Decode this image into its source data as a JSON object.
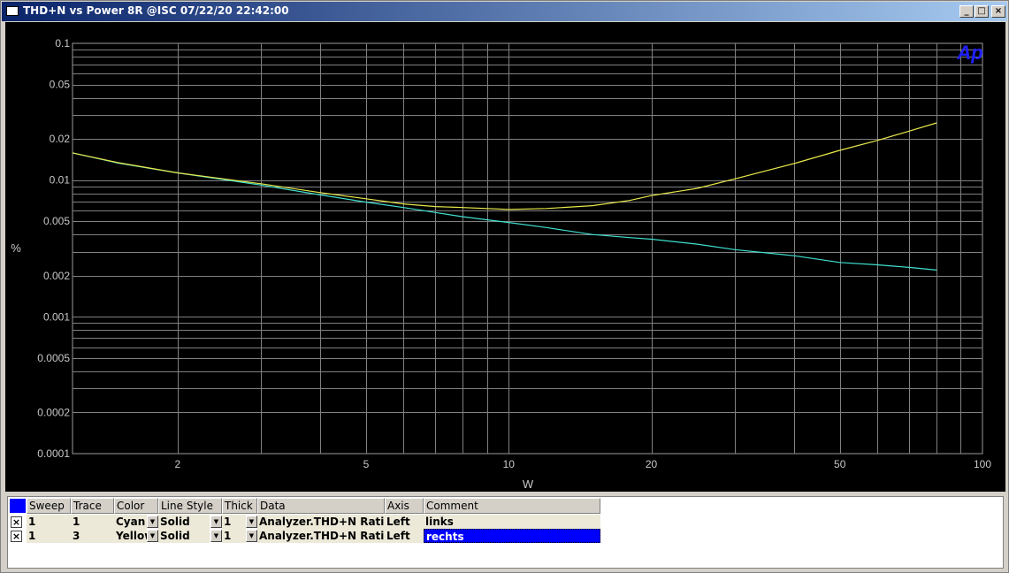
{
  "window": {
    "title": "THD+N vs Power 8R @ISC  07/22/20 22:42:00",
    "buttons": {
      "minimize": "_",
      "maximize": "□",
      "close": "×"
    }
  },
  "chart_data": {
    "type": "line",
    "title": "",
    "xlabel": "W",
    "ylabel": "%",
    "x_scale": "log",
    "y_scale": "log",
    "xlim": [
      1.2,
      100
    ],
    "ylim": [
      0.0001,
      0.1
    ],
    "grid": true,
    "logo": "Ap",
    "x_tick_labels": [
      {
        "value": 2,
        "label": "2"
      },
      {
        "value": 5,
        "label": "5"
      },
      {
        "value": 10,
        "label": "10"
      },
      {
        "value": 20,
        "label": "20"
      },
      {
        "value": 50,
        "label": "50"
      },
      {
        "value": 100,
        "label": "100"
      }
    ],
    "y_tick_labels": [
      {
        "value": 0.1,
        "label": "0.1"
      },
      {
        "value": 0.05,
        "label": "0.05"
      },
      {
        "value": 0.02,
        "label": "0.02"
      },
      {
        "value": 0.01,
        "label": "0.01"
      },
      {
        "value": 0.005,
        "label": "0.005"
      },
      {
        "value": 0.002,
        "label": "0.002"
      },
      {
        "value": 0.001,
        "label": "0.001"
      },
      {
        "value": 0.0005,
        "label": "0.0005"
      },
      {
        "value": 0.0002,
        "label": "0.0002"
      },
      {
        "value": 0.0001,
        "label": "0.0001"
      }
    ],
    "series": [
      {
        "name": "links",
        "color": "#40e0d0",
        "x": [
          1.2,
          1.5,
          2,
          3,
          4,
          5,
          6,
          7,
          8,
          10,
          12,
          15,
          18,
          20,
          25,
          30,
          40,
          50,
          60,
          70,
          80
        ],
        "y": [
          0.0158,
          0.0133,
          0.0113,
          0.0092,
          0.0078,
          0.0069,
          0.0063,
          0.0058,
          0.0054,
          0.0049,
          0.0045,
          0.004,
          0.0038,
          0.0037,
          0.0034,
          0.0031,
          0.0028,
          0.0025,
          0.0024,
          0.0023,
          0.0022
        ]
      },
      {
        "name": "rechts",
        "color": "#e8e84c",
        "x": [
          1.2,
          1.5,
          2,
          3,
          4,
          5,
          6,
          7,
          8,
          10,
          12,
          15,
          18,
          20,
          25,
          30,
          40,
          50,
          60,
          70,
          80
        ],
        "y": [
          0.0158,
          0.0134,
          0.0113,
          0.0094,
          0.0081,
          0.0073,
          0.0067,
          0.0064,
          0.0063,
          0.0061,
          0.0062,
          0.0065,
          0.0071,
          0.0077,
          0.0087,
          0.0102,
          0.0132,
          0.0165,
          0.0195,
          0.0228,
          0.0262
        ]
      }
    ]
  },
  "table": {
    "headers": [
      "Sweep",
      "Trace",
      "Color",
      "Line Style",
      "Thick",
      "Data",
      "Axis",
      "Comment"
    ],
    "rows": [
      {
        "checked": "×",
        "sweep": "1",
        "trace": "1",
        "color": "Cyan",
        "line_style": "Solid",
        "thick": "1",
        "data": "Analyzer.THD+N Ratio A",
        "axis": "Left",
        "comment": "links"
      },
      {
        "checked": "×",
        "sweep": "1",
        "trace": "3",
        "color": "Yellow",
        "line_style": "Solid",
        "thick": "1",
        "data": "Analyzer.THD+N Ratio B",
        "axis": "Left",
        "comment": "rechts"
      }
    ]
  }
}
